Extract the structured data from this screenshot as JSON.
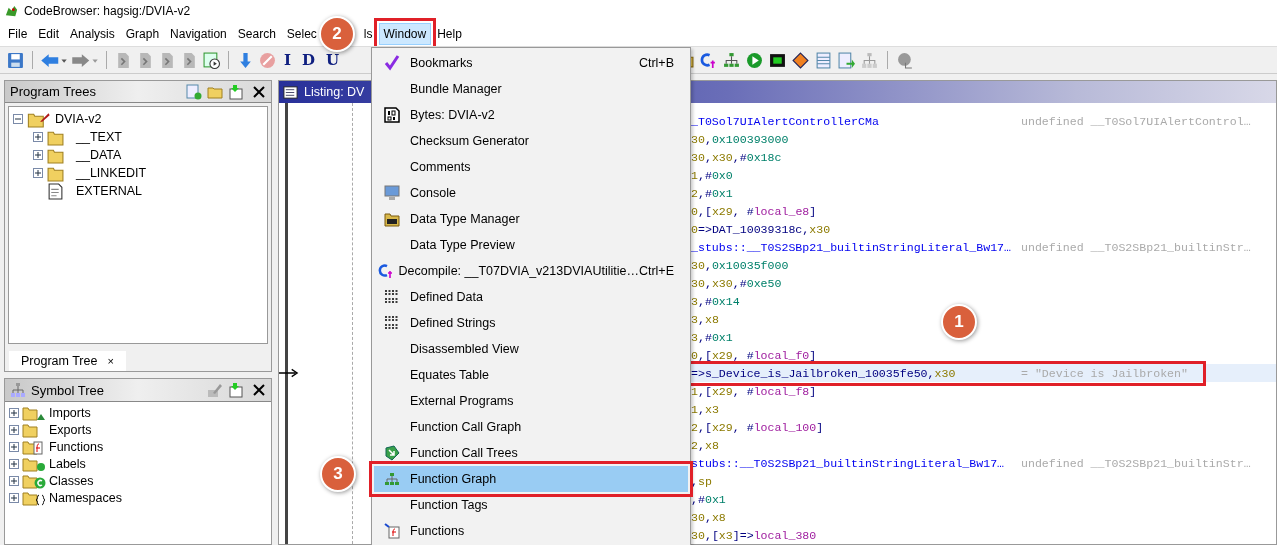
{
  "window": {
    "title": "CodeBrowser: hagsig:/DVIA-v2"
  },
  "menu_bar": [
    {
      "label": "File",
      "selected": false,
      "annotated": false
    },
    {
      "label": "Edit",
      "selected": false,
      "annotated": false
    },
    {
      "label": "Analysis",
      "selected": false,
      "annotated": false
    },
    {
      "label": "Graph",
      "selected": false,
      "annotated": false
    },
    {
      "label": "Navigation",
      "selected": false,
      "annotated": false
    },
    {
      "label": "Search",
      "selected": false,
      "annotated": false
    },
    {
      "label": "Selec",
      "selected": false,
      "annotated": false
    },
    {
      "label": "ls",
      "selected": false,
      "annotated": false
    },
    {
      "label": "Window",
      "selected": true,
      "annotated": true
    },
    {
      "label": "Help",
      "selected": false,
      "annotated": false
    }
  ],
  "toolbar": {
    "letter_buttons": [
      "I",
      "D",
      "U"
    ]
  },
  "program_trees": {
    "title": "Program Trees",
    "tab": "Program Tree",
    "tab_close": "×",
    "tree": [
      {
        "label": "DVIA-v2",
        "kind": "program",
        "expanded": true,
        "children": [
          {
            "label": "__TEXT",
            "kind": "folder",
            "expanded": false
          },
          {
            "label": "__DATA",
            "kind": "folder",
            "expanded": false
          },
          {
            "label": "__LINKEDIT",
            "kind": "folder",
            "expanded": false
          },
          {
            "label": "EXTERNAL",
            "kind": "file"
          }
        ]
      }
    ]
  },
  "symbol_tree": {
    "title": "Symbol Tree",
    "items": [
      {
        "label": "Imports",
        "kind": "imports",
        "expanded": false
      },
      {
        "label": "Exports",
        "kind": "exports",
        "expanded": false
      },
      {
        "label": "Functions",
        "kind": "functions",
        "expanded": false
      },
      {
        "label": "Labels",
        "kind": "labels",
        "expanded": false
      },
      {
        "label": "Classes",
        "kind": "classes",
        "expanded": false
      },
      {
        "label": "Namespaces",
        "kind": "namespaces",
        "expanded": false
      }
    ]
  },
  "listing": {
    "title": "Listing: DV",
    "lines": [
      {
        "selected": false,
        "annotated": false,
        "parts": [
          {
            "kind": "sym",
            "text": "_T0Sol7UIAlertControllerCMa"
          }
        ],
        "comment": "undefined __T0Sol7UIAlertControl…"
      },
      {
        "selected": false,
        "annotated": false,
        "parts": [
          {
            "kind": "reg",
            "text": "30"
          },
          {
            "kind": "plain",
            "text": ","
          },
          {
            "kind": "num",
            "text": "0x100393000"
          }
        ]
      },
      {
        "selected": false,
        "annotated": false,
        "parts": [
          {
            "kind": "reg",
            "text": "30"
          },
          {
            "kind": "plain",
            "text": ","
          },
          {
            "kind": "reg",
            "text": "x30"
          },
          {
            "kind": "plain",
            "text": ",#"
          },
          {
            "kind": "num",
            "text": "0x18c"
          }
        ]
      },
      {
        "selected": false,
        "annotated": false,
        "parts": [
          {
            "kind": "reg",
            "text": "1"
          },
          {
            "kind": "plain",
            "text": ",#"
          },
          {
            "kind": "num",
            "text": "0x0"
          }
        ]
      },
      {
        "selected": false,
        "annotated": false,
        "parts": [
          {
            "kind": "reg",
            "text": "2"
          },
          {
            "kind": "plain",
            "text": ",#"
          },
          {
            "kind": "num",
            "text": "0x1"
          }
        ]
      },
      {
        "selected": false,
        "annotated": false,
        "parts": [
          {
            "kind": "reg",
            "text": "0"
          },
          {
            "kind": "plain",
            "text": ",["
          },
          {
            "kind": "reg",
            "text": "x29"
          },
          {
            "kind": "plain",
            "text": ", #"
          },
          {
            "kind": "local",
            "text": "local_e8"
          },
          {
            "kind": "plain",
            "text": "]"
          }
        ]
      },
      {
        "selected": false,
        "annotated": false,
        "parts": [
          {
            "kind": "reg",
            "text": "0"
          },
          {
            "kind": "plain",
            "text": "=>DAT_10039318c,"
          },
          {
            "kind": "reg",
            "text": "x30"
          }
        ]
      },
      {
        "selected": false,
        "annotated": false,
        "parts": [
          {
            "kind": "sym",
            "text": "_stubs::__T0S2SBp21_builtinStringLiteral_Bw17…"
          }
        ],
        "comment": "undefined __T0S2SBp21_builtinStr…"
      },
      {
        "selected": false,
        "annotated": false,
        "parts": [
          {
            "kind": "reg",
            "text": "30"
          },
          {
            "kind": "plain",
            "text": ","
          },
          {
            "kind": "num",
            "text": "0x10035f000"
          }
        ]
      },
      {
        "selected": false,
        "annotated": false,
        "parts": [
          {
            "kind": "reg",
            "text": "30"
          },
          {
            "kind": "plain",
            "text": ","
          },
          {
            "kind": "reg",
            "text": "x30"
          },
          {
            "kind": "plain",
            "text": ",#"
          },
          {
            "kind": "num",
            "text": "0xe50"
          }
        ]
      },
      {
        "selected": false,
        "annotated": false,
        "parts": [
          {
            "kind": "reg",
            "text": "3"
          },
          {
            "kind": "plain",
            "text": ",#"
          },
          {
            "kind": "num",
            "text": "0x14"
          }
        ]
      },
      {
        "selected": false,
        "annotated": false,
        "parts": [
          {
            "kind": "reg",
            "text": "3"
          },
          {
            "kind": "plain",
            "text": ","
          },
          {
            "kind": "reg",
            "text": "x8"
          }
        ]
      },
      {
        "selected": false,
        "annotated": false,
        "parts": [
          {
            "kind": "reg",
            "text": "3"
          },
          {
            "kind": "plain",
            "text": ",#"
          },
          {
            "kind": "num",
            "text": "0x1"
          }
        ]
      },
      {
        "selected": false,
        "annotated": false,
        "parts": [
          {
            "kind": "reg",
            "text": "0"
          },
          {
            "kind": "plain",
            "text": ",["
          },
          {
            "kind": "reg",
            "text": "x29"
          },
          {
            "kind": "plain",
            "text": ", #"
          },
          {
            "kind": "local",
            "text": "local_f0"
          },
          {
            "kind": "plain",
            "text": "]"
          }
        ]
      },
      {
        "selected": true,
        "annotated": true,
        "parts": [
          {
            "kind": "plain",
            "text": "=>s_Device_is_Jailbroken_10035fe50,"
          },
          {
            "kind": "reg",
            "text": "x30"
          }
        ],
        "comment": "= \"Device is Jailbroken\""
      },
      {
        "selected": false,
        "annotated": false,
        "parts": [
          {
            "kind": "reg",
            "text": "1"
          },
          {
            "kind": "plain",
            "text": ",["
          },
          {
            "kind": "reg",
            "text": "x29"
          },
          {
            "kind": "plain",
            "text": ", #"
          },
          {
            "kind": "local",
            "text": "local_f8"
          },
          {
            "kind": "plain",
            "text": "]"
          }
        ]
      },
      {
        "selected": false,
        "annotated": false,
        "parts": [
          {
            "kind": "reg",
            "text": "1"
          },
          {
            "kind": "plain",
            "text": ","
          },
          {
            "kind": "reg",
            "text": "x3"
          }
        ]
      },
      {
        "selected": false,
        "annotated": false,
        "parts": [
          {
            "kind": "reg",
            "text": "2"
          },
          {
            "kind": "plain",
            "text": ",["
          },
          {
            "kind": "reg",
            "text": "x29"
          },
          {
            "kind": "plain",
            "text": ", #"
          },
          {
            "kind": "local",
            "text": "local_100"
          },
          {
            "kind": "plain",
            "text": "]"
          }
        ]
      },
      {
        "selected": false,
        "annotated": false,
        "parts": [
          {
            "kind": "reg",
            "text": "2"
          },
          {
            "kind": "plain",
            "text": ","
          },
          {
            "kind": "reg",
            "text": "x8"
          }
        ]
      },
      {
        "selected": false,
        "annotated": false,
        "parts": [
          {
            "kind": "sym",
            "text": "stubs::__T0S2SBp21_builtinStringLiteral_Bw17…"
          }
        ],
        "comment": "undefined __T0S2SBp21_builtinStr…"
      },
      {
        "selected": false,
        "annotated": false,
        "parts": [
          {
            "kind": "plain",
            "text": ","
          },
          {
            "kind": "reg",
            "text": "sp"
          }
        ]
      },
      {
        "selected": false,
        "annotated": false,
        "parts": [
          {
            "kind": "plain",
            "text": ",#"
          },
          {
            "kind": "num",
            "text": "0x1"
          }
        ]
      },
      {
        "selected": false,
        "annotated": false,
        "parts": [
          {
            "kind": "reg",
            "text": "30"
          },
          {
            "kind": "plain",
            "text": ","
          },
          {
            "kind": "reg",
            "text": "x8"
          }
        ]
      },
      {
        "selected": false,
        "annotated": false,
        "parts": [
          {
            "kind": "reg",
            "text": "30"
          },
          {
            "kind": "plain",
            "text": ",["
          },
          {
            "kind": "reg",
            "text": "x3"
          },
          {
            "kind": "plain",
            "text": "]=>"
          },
          {
            "kind": "local",
            "text": "local_380"
          }
        ]
      }
    ]
  },
  "window_menu": {
    "items": [
      {
        "label": "Bookmarks",
        "kind": "check",
        "shortcut": "Ctrl+B",
        "selected": false,
        "annotated": false
      },
      {
        "label": "Bundle Manager",
        "kind": "none",
        "selected": false,
        "annotated": false
      },
      {
        "label": "Bytes: DVIA-v2",
        "kind": "bytes",
        "selected": false,
        "annotated": false
      },
      {
        "label": "Checksum Generator",
        "kind": "none",
        "selected": false,
        "annotated": false
      },
      {
        "label": "Comments",
        "kind": "none",
        "selected": false,
        "annotated": false
      },
      {
        "label": "Console",
        "kind": "console",
        "selected": false,
        "annotated": false
      },
      {
        "label": "Data Type Manager",
        "kind": "datatype",
        "selected": false,
        "annotated": false
      },
      {
        "label": "Data Type Preview",
        "kind": "none",
        "selected": false,
        "annotated": false
      },
      {
        "label": "Decompile: __T07DVIA_v213DVIAUtilitie…",
        "kind": "decompile",
        "shortcut": "Ctrl+E",
        "selected": false,
        "annotated": false
      },
      {
        "label": "Defined Data",
        "kind": "data",
        "selected": false,
        "annotated": false
      },
      {
        "label": "Defined Strings",
        "kind": "data",
        "selected": false,
        "annotated": false
      },
      {
        "label": "Disassembled View",
        "kind": "none",
        "selected": false,
        "annotated": false
      },
      {
        "label": "Equates Table",
        "kind": "none",
        "selected": false,
        "annotated": false
      },
      {
        "label": "External Programs",
        "kind": "none",
        "selected": false,
        "annotated": false
      },
      {
        "label": "Function Call Graph",
        "kind": "none",
        "selected": false,
        "annotated": false
      },
      {
        "label": "Function Call Trees",
        "kind": "calltree",
        "selected": false,
        "annotated": false
      },
      {
        "label": "Function Graph",
        "kind": "graph",
        "selected": true,
        "annotated": true
      },
      {
        "label": "Function Tags",
        "kind": "none",
        "selected": false,
        "annotated": false
      },
      {
        "label": "Functions",
        "kind": "functions",
        "selected": false,
        "annotated": false
      }
    ]
  },
  "callouts": [
    {
      "number": "1"
    },
    {
      "number": "2"
    },
    {
      "number": "3"
    }
  ]
}
